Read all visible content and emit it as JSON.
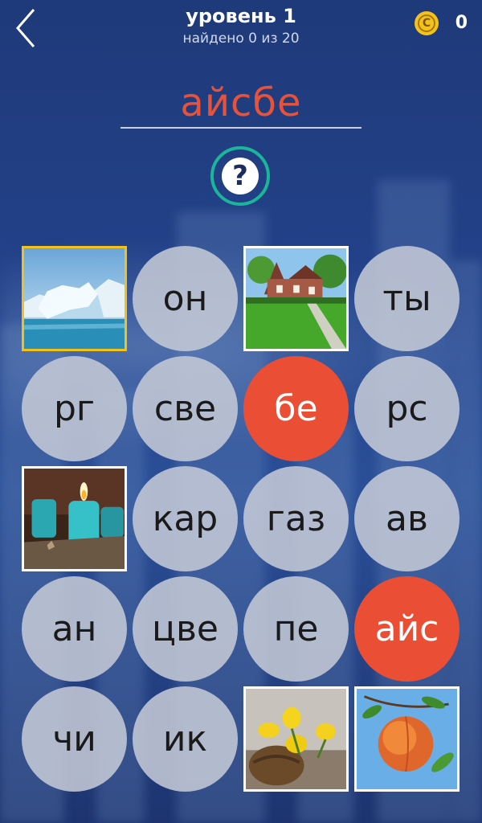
{
  "header": {
    "title": "уровень 1",
    "subtitle": "найдено 0 из 20",
    "coins": "0"
  },
  "answer": {
    "text": "айсбе",
    "color": "#e8523a"
  },
  "hint": {
    "label": "?"
  },
  "tiles": [
    {
      "type": "image",
      "icon": "iceberg-image",
      "selected": true
    },
    {
      "type": "syllable",
      "text": "он"
    },
    {
      "type": "image",
      "icon": "house-lawn-image"
    },
    {
      "type": "syllable",
      "text": "ты"
    },
    {
      "type": "syllable",
      "text": "рг"
    },
    {
      "type": "syllable",
      "text": "све"
    },
    {
      "type": "syllable",
      "text": "бе",
      "selected": true
    },
    {
      "type": "syllable",
      "text": "рс"
    },
    {
      "type": "image",
      "icon": "candles-image"
    },
    {
      "type": "syllable",
      "text": "кар"
    },
    {
      "type": "syllable",
      "text": "газ"
    },
    {
      "type": "syllable",
      "text": "ав"
    },
    {
      "type": "syllable",
      "text": "ан"
    },
    {
      "type": "syllable",
      "text": "цве"
    },
    {
      "type": "syllable",
      "text": "пе"
    },
    {
      "type": "syllable",
      "text": "айс",
      "selected": true
    },
    {
      "type": "syllable",
      "text": "чи"
    },
    {
      "type": "syllable",
      "text": "ик"
    },
    {
      "type": "image",
      "icon": "yellow-flowers-image"
    },
    {
      "type": "image",
      "icon": "peach-image"
    }
  ],
  "colors": {
    "selected_bubble": "#ea4f36",
    "bubble": "#c4c8d6",
    "hint_ring": "#1bb59a",
    "coin": "#f4c21a",
    "selected_image_border": "#f2c21b"
  }
}
